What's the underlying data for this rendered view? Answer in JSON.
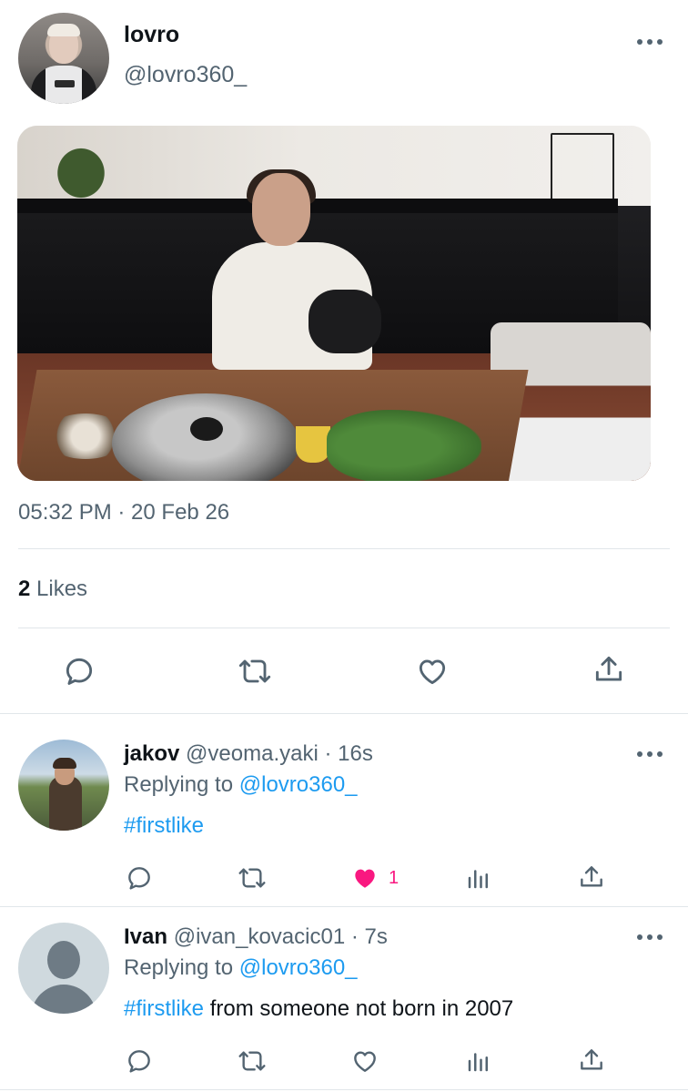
{
  "main_tweet": {
    "display_name": "lovro",
    "handle": "@lovro360_",
    "timestamp": "05:32 PM · 20 Feb 26",
    "likes_count": "2",
    "likes_label": "Likes"
  },
  "replies": [
    {
      "display_name": "jakov",
      "handle": "@veoma.yaki",
      "time": "· 16s",
      "replying_prefix": "Replying to",
      "replying_to": "@lovro360_",
      "hashtag": "#firstlike",
      "text": "",
      "like_count": "1",
      "liked": true
    },
    {
      "display_name": "Ivan",
      "handle": "@ivan_kovacic01",
      "time": "· 7s",
      "replying_prefix": "Replying to",
      "replying_to": "@lovro360_",
      "hashtag": "#firstlike",
      "text": " from someone not born in 2007",
      "like_count": "",
      "liked": false
    }
  ],
  "colors": {
    "text_primary": "#0f1419",
    "text_secondary": "#536471",
    "link": "#1d9bf0",
    "liked": "#f91880",
    "divider": "#e1e6ea"
  },
  "icons": [
    "more-icon",
    "reply-icon",
    "retweet-icon",
    "heart-icon",
    "share-icon",
    "analytics-icon"
  ]
}
